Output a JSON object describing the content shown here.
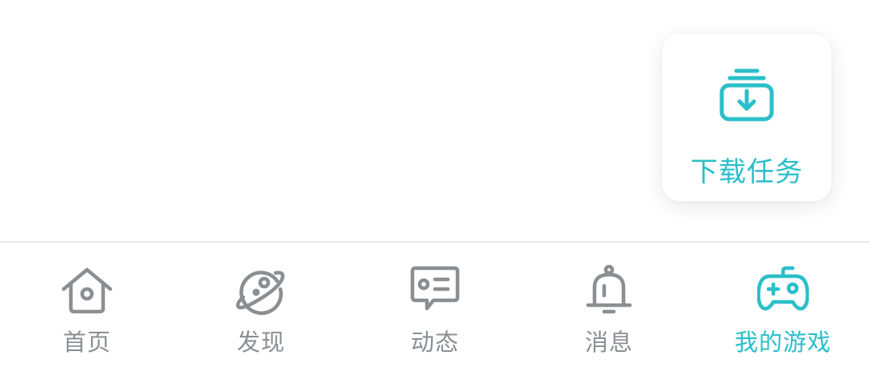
{
  "colors": {
    "accent": "#2ABFC9",
    "inactive": "#8a8f93",
    "divider": "#d9d9d9"
  },
  "download_card": {
    "icon": "download-tray-icon",
    "label": "下载任务"
  },
  "tabs": [
    {
      "label": "首页",
      "icon": "home-icon",
      "active": false
    },
    {
      "label": "发现",
      "icon": "planet-icon",
      "active": false
    },
    {
      "label": "动态",
      "icon": "message-card-icon",
      "active": false
    },
    {
      "label": "消息",
      "icon": "bell-icon",
      "active": false
    },
    {
      "label": "我的游戏",
      "icon": "gamepad-icon",
      "active": true
    }
  ]
}
